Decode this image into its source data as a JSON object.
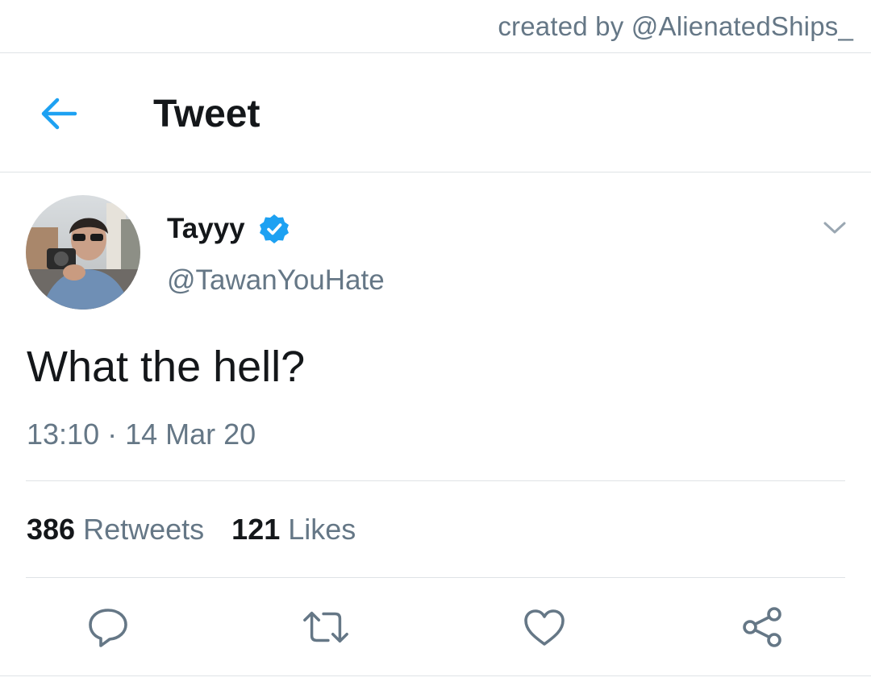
{
  "credit": "created by @AlienatedShips_",
  "header": {
    "back_icon": "arrow-left-icon",
    "title": "Tweet"
  },
  "tweet": {
    "author": {
      "display_name": "Tayyy",
      "handle": "@TawanYouHate",
      "verified": true
    },
    "text": "What the hell?",
    "timestamp": "13:10 · 14 Mar 20",
    "stats": {
      "retweets_count": "386",
      "retweets_label": "Retweets",
      "likes_count": "121",
      "likes_label": "Likes"
    },
    "actions": [
      "reply-icon",
      "retweet-icon",
      "like-icon",
      "share-icon"
    ]
  },
  "colors": {
    "accent": "#1da1f2",
    "secondary_text": "#657786",
    "primary_text": "#14171a",
    "divider": "#dfe3e6"
  }
}
